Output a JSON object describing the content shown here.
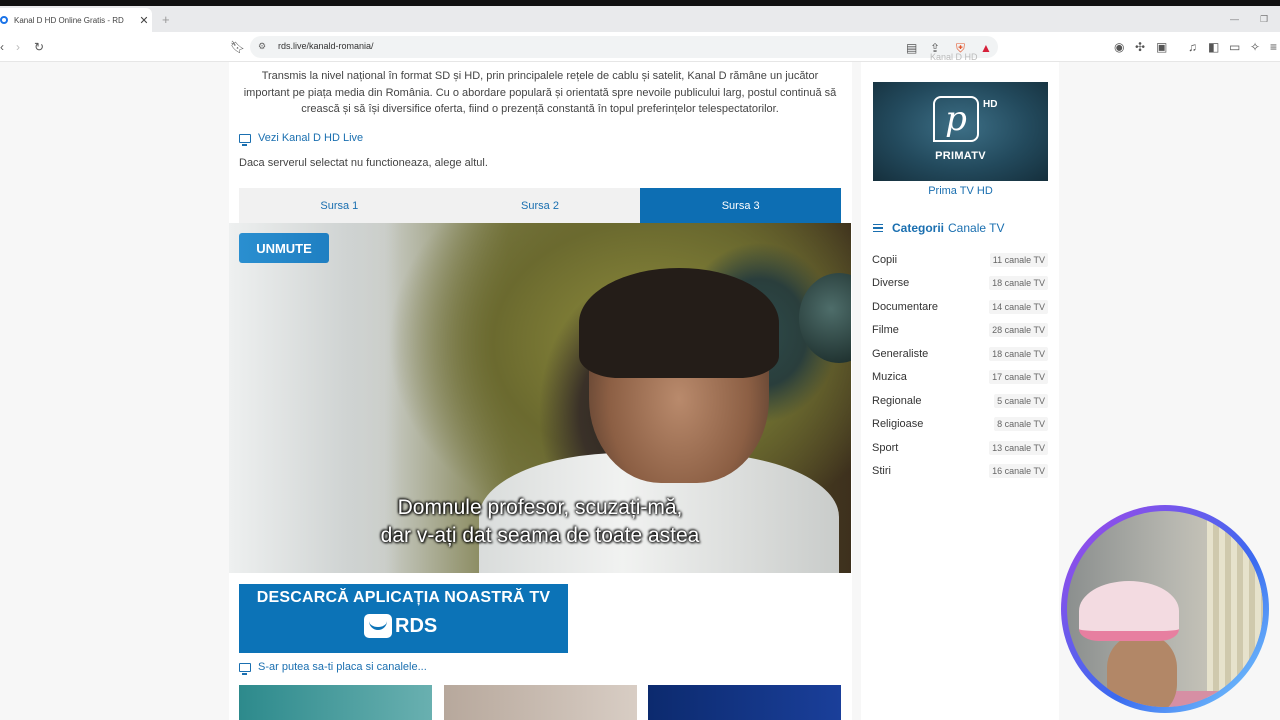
{
  "browser": {
    "tab_title": "Kanal D HD Online Gratis - RD",
    "tab_close": "✕",
    "new_tab": "+",
    "url": "rds.live/kanald-romania/",
    "minimize": "—",
    "restore": "❐"
  },
  "article": {
    "intro": "Transmis la nivel național în format SD și HD, prin principalele rețele de cablu și satelit, Kanal D rămâne un jucător important pe piața media din România. Cu o abordare populară și orientată spre nevoile publicului larg, postul continuă să crească și să își diversifice oferta, fiind o prezență constantă în topul preferințelor telespectatorilor.",
    "live_link": "Vezi Kanal D HD Live",
    "server_note": "Daca serverul selectat nu functioneaza, alege altul."
  },
  "sources": {
    "items": [
      "Sursa 1",
      "Sursa 2",
      "Sursa 3"
    ],
    "active_index": 2
  },
  "player": {
    "unmute_label": "UNMUTE",
    "subtitle_line1": "Domnule profesor, scuzați-mă,",
    "subtitle_line2": "dar v-ați dat seama de toate astea"
  },
  "banner": {
    "title": "DESCARCĂ APLICAȚIA NOASTRĂ TV",
    "logo_text": "RDS"
  },
  "suggestions": {
    "label": "S-ar putea sa-ti placa si canalele..."
  },
  "sidebar": {
    "top_partial": "Kanal D HD",
    "featured": {
      "logo_text": "PRIMATV",
      "logo_hd": "HD",
      "caption": "Prima TV HD"
    },
    "categories_title_bold": "Categorii",
    "categories_title_rest": "Canale TV",
    "categories": [
      {
        "name": "Copii",
        "count": "11 canale TV"
      },
      {
        "name": "Diverse",
        "count": "18 canale TV"
      },
      {
        "name": "Documentare",
        "count": "14 canale TV"
      },
      {
        "name": "Filme",
        "count": "28 canale TV"
      },
      {
        "name": "Generaliste",
        "count": "18 canale TV"
      },
      {
        "name": "Muzica",
        "count": "17 canale TV"
      },
      {
        "name": "Regionale",
        "count": "5 canale TV"
      },
      {
        "name": "Religioase",
        "count": "8 canale TV"
      },
      {
        "name": "Sport",
        "count": "13 canale TV"
      },
      {
        "name": "Stiri",
        "count": "16 canale TV"
      }
    ]
  },
  "colors": {
    "accent": "#0d6eb3",
    "link": "#1a6fb0"
  }
}
